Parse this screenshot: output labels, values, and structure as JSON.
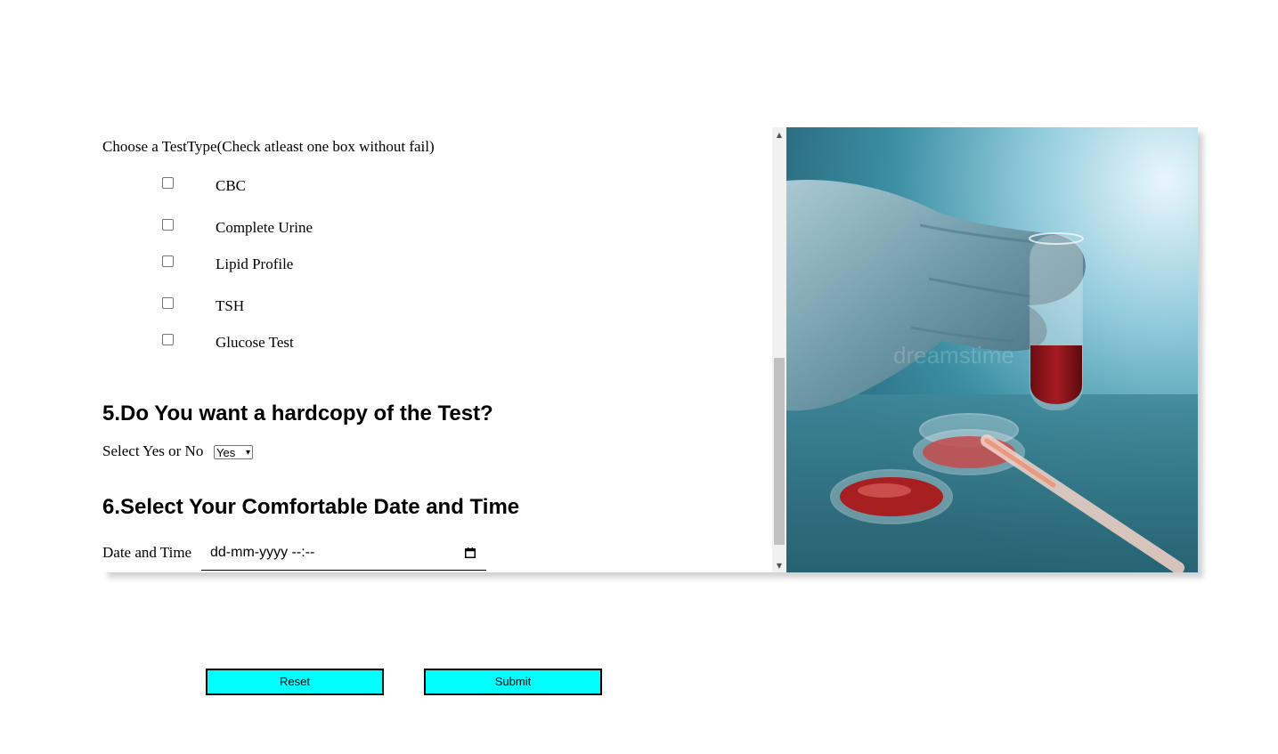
{
  "form": {
    "test_prompt": "Choose a TestType(Check atleast one box without fail)",
    "test_options": [
      {
        "label": "CBC",
        "checked": false
      },
      {
        "label": "Complete Urine",
        "checked": false
      },
      {
        "label": "Lipid Profile",
        "checked": false
      },
      {
        "label": "TSH",
        "checked": false
      },
      {
        "label": "Glucose Test",
        "checked": false
      }
    ],
    "q5_heading": "5.Do You want a hardcopy of the Test?",
    "q5_label": "Select Yes or No",
    "q5_selected": "Yes",
    "q6_heading": "6.Select Your Comfortable Date and Time",
    "q6_label": "Date and Time",
    "q6_placeholder": "dd-mm-yyyy --:--"
  },
  "buttons": {
    "reset_label": "Reset",
    "submit_label": "Submit",
    "color": "#00ffff"
  },
  "photo": {
    "subject": "gloved hand holding test tube with blood, petri dishes and pipette",
    "watermark": "dreamstime"
  }
}
